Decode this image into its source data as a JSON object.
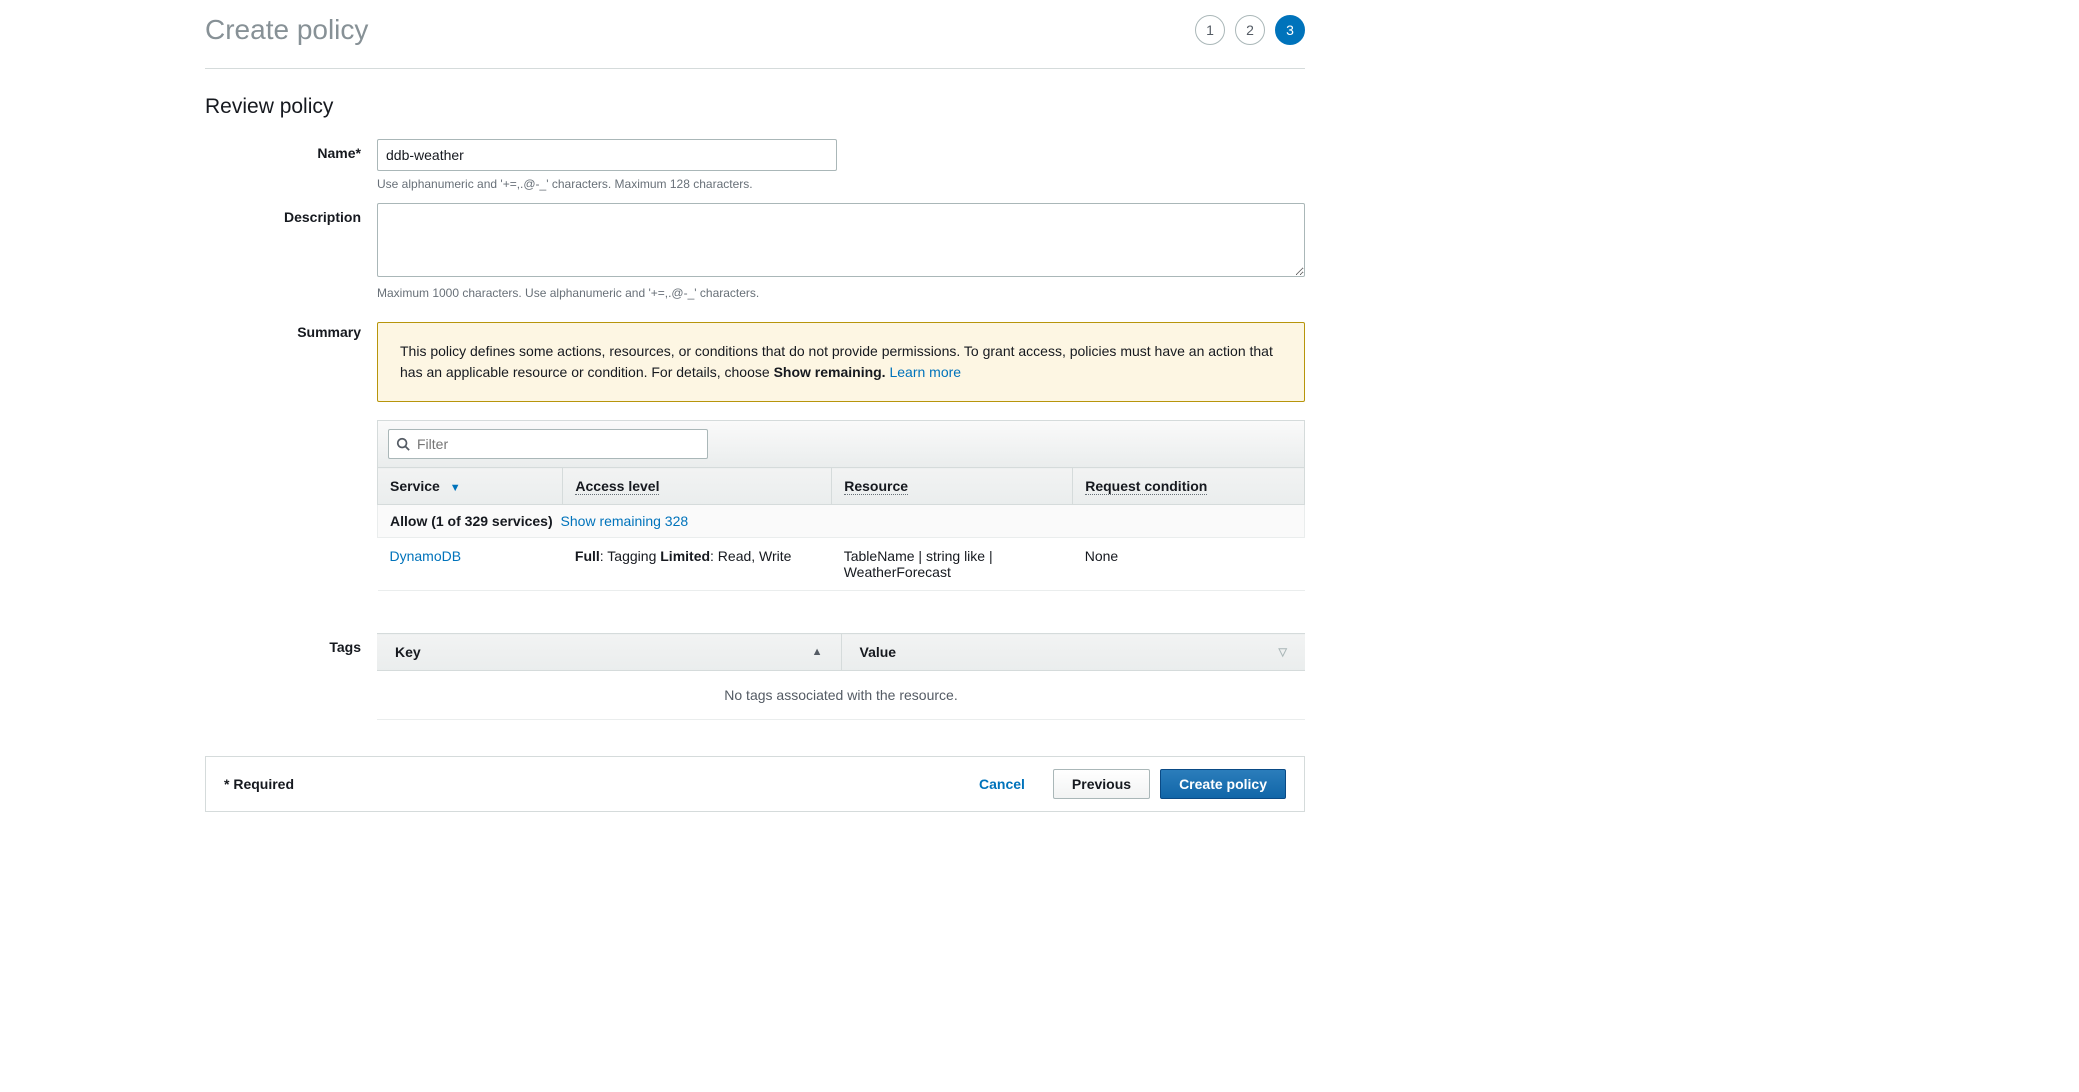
{
  "header": {
    "title": "Create policy",
    "steps": {
      "s1": "1",
      "s2": "2",
      "s3": "3"
    }
  },
  "section_title": "Review policy",
  "form": {
    "name_label": "Name*",
    "name_value": "ddb-weather",
    "name_hint": "Use alphanumeric and '+=,.@-_' characters. Maximum 128 characters.",
    "description_label": "Description",
    "description_value": "",
    "description_hint": "Maximum 1000 characters. Use alphanumeric and '+=,.@-_' characters.",
    "summary_label": "Summary",
    "tags_label": "Tags"
  },
  "warning": {
    "text_before_bold": "This policy defines some actions, resources, or conditions that do not provide permissions. To grant access, policies must have an action that has an applicable resource or condition. For details, choose ",
    "bold": "Show remaining.",
    "link": "Learn more"
  },
  "filter": {
    "placeholder": "Filter"
  },
  "summary_table": {
    "cols": {
      "service": "Service",
      "access": "Access level",
      "resource": "Resource",
      "condition": "Request condition"
    },
    "allow_prefix": "Allow (1 of 329 services)",
    "show_remaining": "Show remaining 328",
    "row": {
      "service": "DynamoDB",
      "access_full_label": "Full",
      "access_full_val": ": Tagging ",
      "access_limited_label": "Limited",
      "access_limited_val": ": Read, Write",
      "resource": "TableName | string like | WeatherForecast",
      "condition": "None"
    }
  },
  "tags_table": {
    "key_col": "Key",
    "value_col": "Value",
    "empty": "No tags associated with the resource."
  },
  "footer": {
    "required": "* Required",
    "cancel": "Cancel",
    "previous": "Previous",
    "create": "Create policy"
  }
}
